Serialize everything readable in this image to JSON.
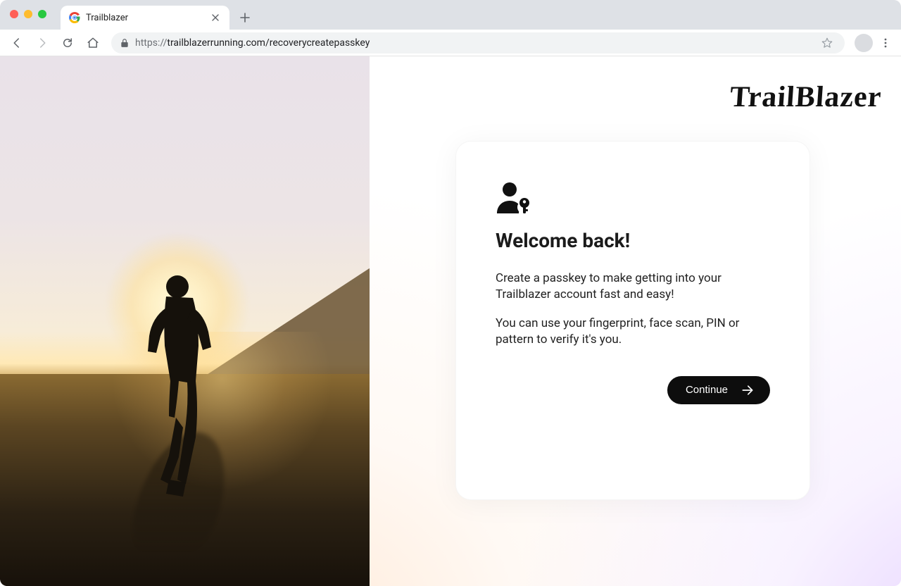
{
  "browser": {
    "tab_title": "Trailblazer",
    "url_scheme": "https://",
    "url_rest": "trailblazerrunning.com/recoverycreatepasskey"
  },
  "brand": "TrailBlazer",
  "card": {
    "heading": "Welcome back!",
    "para1": "Create a passkey to make getting into your Trailblazer account fast and easy!",
    "para2": "You can use your fingerprint, face scan, PIN or pattern to verify it's you.",
    "cta_label": "Continue"
  }
}
